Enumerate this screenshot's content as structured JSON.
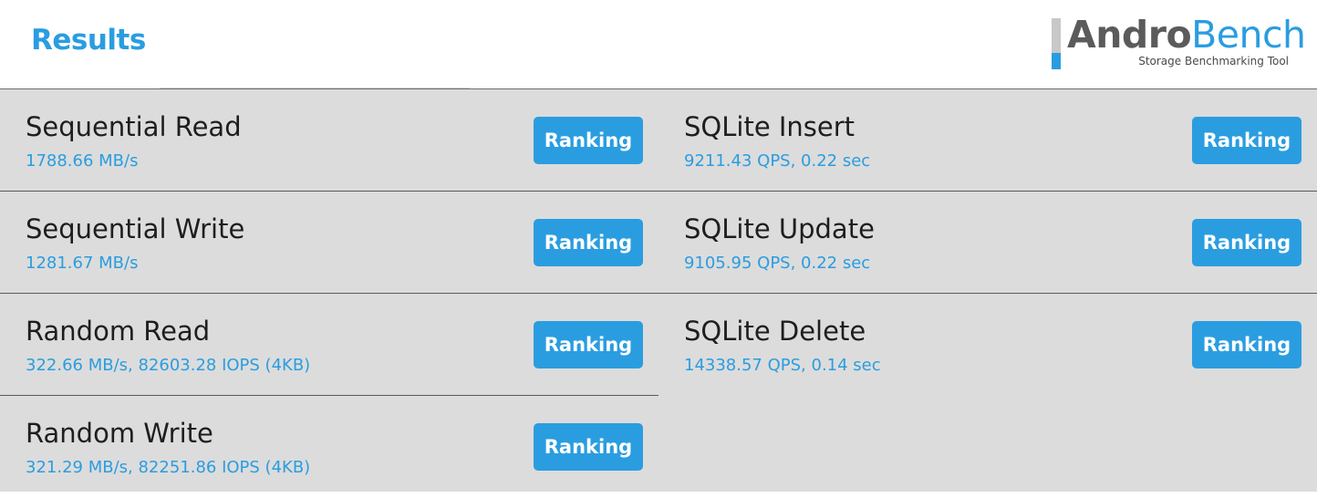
{
  "header": {
    "title": "Results",
    "logo": {
      "andro": "Andro",
      "bench": "Bench",
      "subtitle": "Storage Benchmarking Tool"
    }
  },
  "colors": {
    "accent": "#2a9de0",
    "panel_bg": "#dcdcdc",
    "logo_gray": "#5b5b5b"
  },
  "results_left": [
    {
      "title": "Sequential Read",
      "value": "1788.66 MB/s",
      "button": "Ranking"
    },
    {
      "title": "Sequential Write",
      "value": "1281.67 MB/s",
      "button": "Ranking"
    },
    {
      "title": "Random Read",
      "value": "322.66 MB/s, 82603.28 IOPS (4KB)",
      "button": "Ranking"
    },
    {
      "title": "Random Write",
      "value": "321.29 MB/s, 82251.86 IOPS (4KB)",
      "button": "Ranking"
    }
  ],
  "results_right": [
    {
      "title": "SQLite Insert",
      "value": "9211.43 QPS, 0.22 sec",
      "button": "Ranking"
    },
    {
      "title": "SQLite Update",
      "value": "9105.95 QPS, 0.22 sec",
      "button": "Ranking"
    },
    {
      "title": "SQLite Delete",
      "value": "14338.57 QPS, 0.14 sec",
      "button": "Ranking"
    }
  ]
}
